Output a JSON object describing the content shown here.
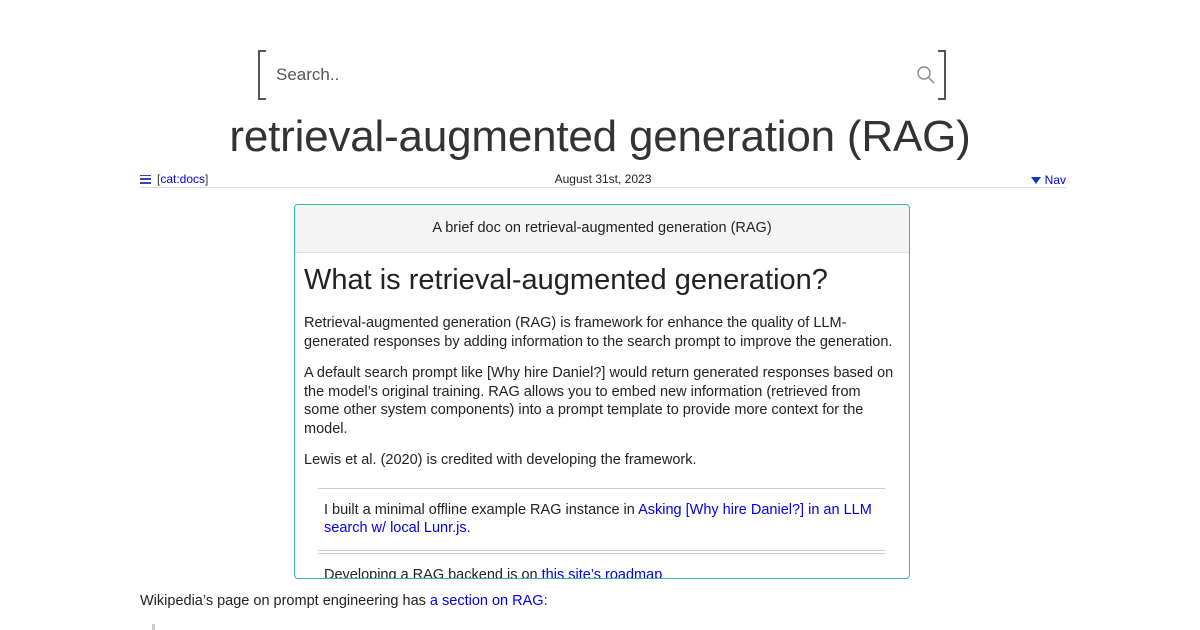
{
  "search": {
    "placeholder": "Search.."
  },
  "page_title": "retrieval-augmented generation (RAG)",
  "meta": {
    "category": "cat:docs",
    "date": "August 31st, 2023",
    "nav_label": "Nav"
  },
  "card": {
    "header": "A brief doc on retrieval-augmented generation (RAG)",
    "heading": "What is retrieval-augmented generation?",
    "paragraphs": [
      "Retrieval-augmented generation (RAG) is framework for enhance the quality of LLM-generated responses by adding information to the search prompt to improve the generation.",
      "A default search prompt like [Why hire Daniel?] would return generated responses based on the model’s original training. RAG allows you to embed new information (retrieved from some other system components) into a prompt template to provide more context for the model.",
      "Lewis et al. (2020) is credited with developing the framework."
    ],
    "note1_text": "I built a minimal offline example RAG instance in ",
    "note1_link": "Asking [Why hire Daniel?] in an LLM search w/ local Lunr.js.",
    "note2_text": "Developing a RAG backend is on ",
    "note2_link": "this site’s roadmap"
  },
  "wiki": {
    "text": "Wikipedia’s page on prompt engineering has ",
    "link": "a section on RAG",
    "suffix": ":"
  }
}
